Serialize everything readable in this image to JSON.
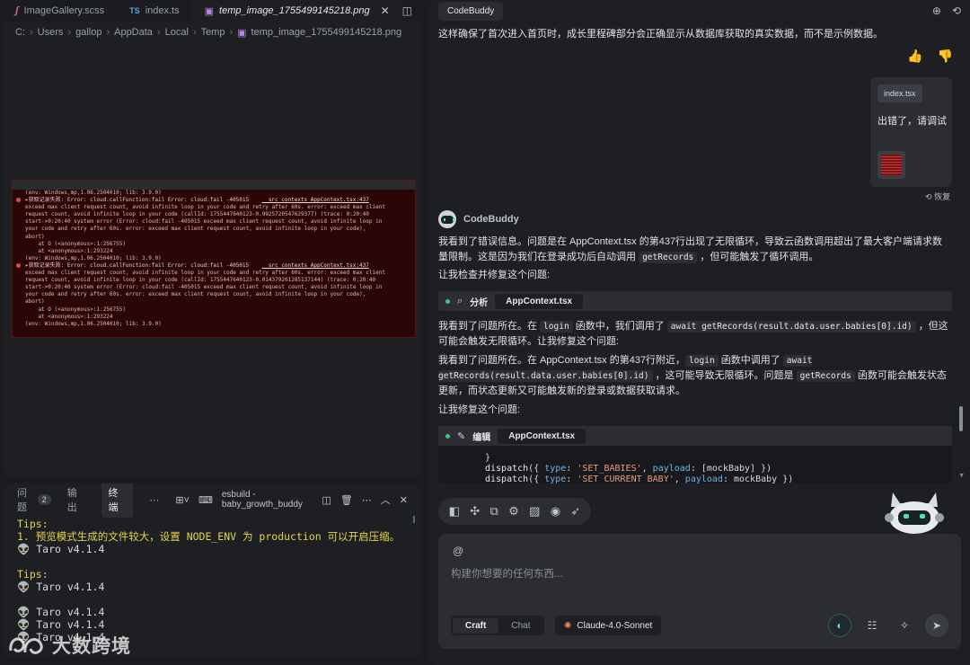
{
  "editor": {
    "tabs": [
      {
        "label": "ImageGallery.scss",
        "icon": "sass-icon"
      },
      {
        "label": "index.ts",
        "icon_text": "TS"
      },
      {
        "label": "temp_image_1755499145218.png",
        "icon": "image-icon",
        "active": true
      }
    ],
    "breadcrumb": [
      "C:",
      "Users",
      "gallop",
      "AppData",
      "Local",
      "Temp",
      "temp_image_1755499145218.png"
    ],
    "error_lines": [
      {
        "text": "(env: Windows,mp,1.06.2504010; lib: 3.9.0)",
        "type": "plain"
      },
      {
        "text": "▸获取记录失败: Error: cloud.callFunction:fail Error: cloud:fail -405015",
        "link": "__src_contexts_AppContext.tsx:437",
        "type": "hdr"
      },
      {
        "text": "exceed max client request count, avoid infinite loop in your code and retry after 60s. error: exceed max client",
        "type": "plain"
      },
      {
        "text": "request count, avoid infinite loop in your code (callId: 1755447640123-0.9925720547629377) (trace: 0:20:40",
        "type": "plain"
      },
      {
        "text": "start->0:20:40 system error (Error: cloud:fail -405015 exceed max client request count, avoid infinite loop in",
        "type": "plain"
      },
      {
        "text": "your code and retry after 60s. error: exceed max client request count, avoid infinite loop in your code),",
        "type": "plain"
      },
      {
        "text": "abort)",
        "type": "plain"
      },
      {
        "text": "    at O (<anonymous>:1:256755)",
        "type": "plain"
      },
      {
        "text": "    at <anonymous>:1:293224",
        "type": "plain"
      },
      {
        "text": "(env: Windows,mp,1.06.2504010; lib: 3.9.0)",
        "type": "plain"
      },
      {
        "text": "▸获取记录失败: Error: cloud.callFunction:fail Error: cloud:fail -405015",
        "link": "__src_contexts_AppContext.tsx:437",
        "type": "hdr"
      },
      {
        "text": "exceed max client request count, avoid infinite loop in your code and retry after 60s. error: exceed max client",
        "type": "plain"
      },
      {
        "text": "request count, avoid infinite loop in your code (callId: 1755447640123-0.014379201285137144) (trace: 0:20:40",
        "type": "plain"
      },
      {
        "text": "start->0:20:40 system error (Error: cloud:fail -405015 exceed max client request count, avoid infinite loop in",
        "type": "plain"
      },
      {
        "text": "your code and retry after 60s. error: exceed max client request count, avoid infinite loop in your code),",
        "type": "plain"
      },
      {
        "text": "abort)",
        "type": "plain"
      },
      {
        "text": "    at O (<anonymous>:1:256755)",
        "type": "plain"
      },
      {
        "text": "    at <anonymous>:1:293224",
        "type": "plain"
      },
      {
        "text": "(env: Windows,mp,1.06.2504010; lib: 3.9.0)",
        "type": "plain"
      }
    ]
  },
  "panel": {
    "tabs": [
      {
        "label": "问题",
        "badge": "2"
      },
      {
        "label": "输出"
      },
      {
        "label": "终端",
        "active": true
      }
    ],
    "terminal_name": "esbuild - baby_growth_buddy",
    "terminal": [
      {
        "text": "Tips:",
        "color": "y"
      },
      {
        "text": "1. 预览模式生成的文件较大，设置 NODE_ENV 为 production 可以开启压缩。",
        "color": "y"
      },
      {
        "text": "👽 Taro v4.1.4",
        "color": "w"
      },
      {
        "text": "",
        "color": "gap"
      },
      {
        "text": "Tips:",
        "color": "y"
      },
      {
        "text": "👽 Taro v4.1.4",
        "color": "w"
      },
      {
        "text": "",
        "color": "gap"
      },
      {
        "text": "👽 Taro v4.1.4",
        "color": "w"
      },
      {
        "text": "👽 Taro v4.1.4",
        "color": "w"
      },
      {
        "text": "👽 Taro v4.1.4",
        "color": "w"
      }
    ]
  },
  "watermark": {
    "text": "大数跨境"
  },
  "chat": {
    "title": "CodeBuddy",
    "intro_text": "这样确保了首次进入首页时，成长里程碑部分会正确显示从数据库获取的真实数据，而不是示例数据。",
    "user_message": {
      "file_chip": "index.tsx",
      "text": "出错了，请调试"
    },
    "restore_label": "恢复",
    "bot_name": "CodeBuddy",
    "reply_1a": "我看到了错误信息。问题是在 AppContext.tsx 的第437行出现了无限循环，导致云函数调用超出了最大客户端请求数量限制。这是因为我们在登录成功后自动调用 ",
    "reply_1_code": "getRecords",
    "reply_1b": " ，但可能触发了循环调用。",
    "reply_2": "让我检查并修复这个问题:",
    "tool_1": {
      "verb": "分析",
      "file": "AppContext.tsx"
    },
    "reply_3a": "我看到了问题所在。在 ",
    "reply_3_code1": "login",
    "reply_3b": " 函数中，我们调用了 ",
    "reply_3_code2": "await getRecords(result.data.user.babies[0].id)",
    "reply_3c": " ，但这可能会触发无限循环。让我修复这个问题:",
    "reply_4a": "我看到了问题所在。在 AppContext.tsx 的第437行附近，",
    "reply_4_code1": "login",
    "reply_4b": " 函数中调用了 ",
    "reply_4_code2": "await getRecords(result.data.user.babies[0].id)",
    "reply_4c": " ，这可能导致无限循环。问题是 ",
    "reply_4_code3": "getRecords",
    "reply_4d": " 函数可能会触发状态更新，而状态更新又可能触发新的登录或数据获取请求。",
    "reply_5": "让我修复这个问题:",
    "tool_2": {
      "verb": "编辑",
      "file": "AppContext.tsx"
    },
    "code_lines": [
      {
        "brace": "}"
      },
      {
        "fn": "dispatch",
        "type_key": "type",
        "type_val": "'SET_BABIES'",
        "payload_key": "payload",
        "payload_val": "[mockBaby]"
      },
      {
        "fn": "dispatch",
        "type_key": "type",
        "type_val": "'SET_CURRENT_BABY'",
        "payload_key": "payload",
        "payload_val": "mockBaby"
      }
    ],
    "composer": {
      "at": "@",
      "placeholder": "构建你想要的任何东西...",
      "modes": [
        "Craft",
        "Chat"
      ],
      "model": "Claude-4.0-Sonnet"
    },
    "accent_color": "#3fc77a"
  }
}
